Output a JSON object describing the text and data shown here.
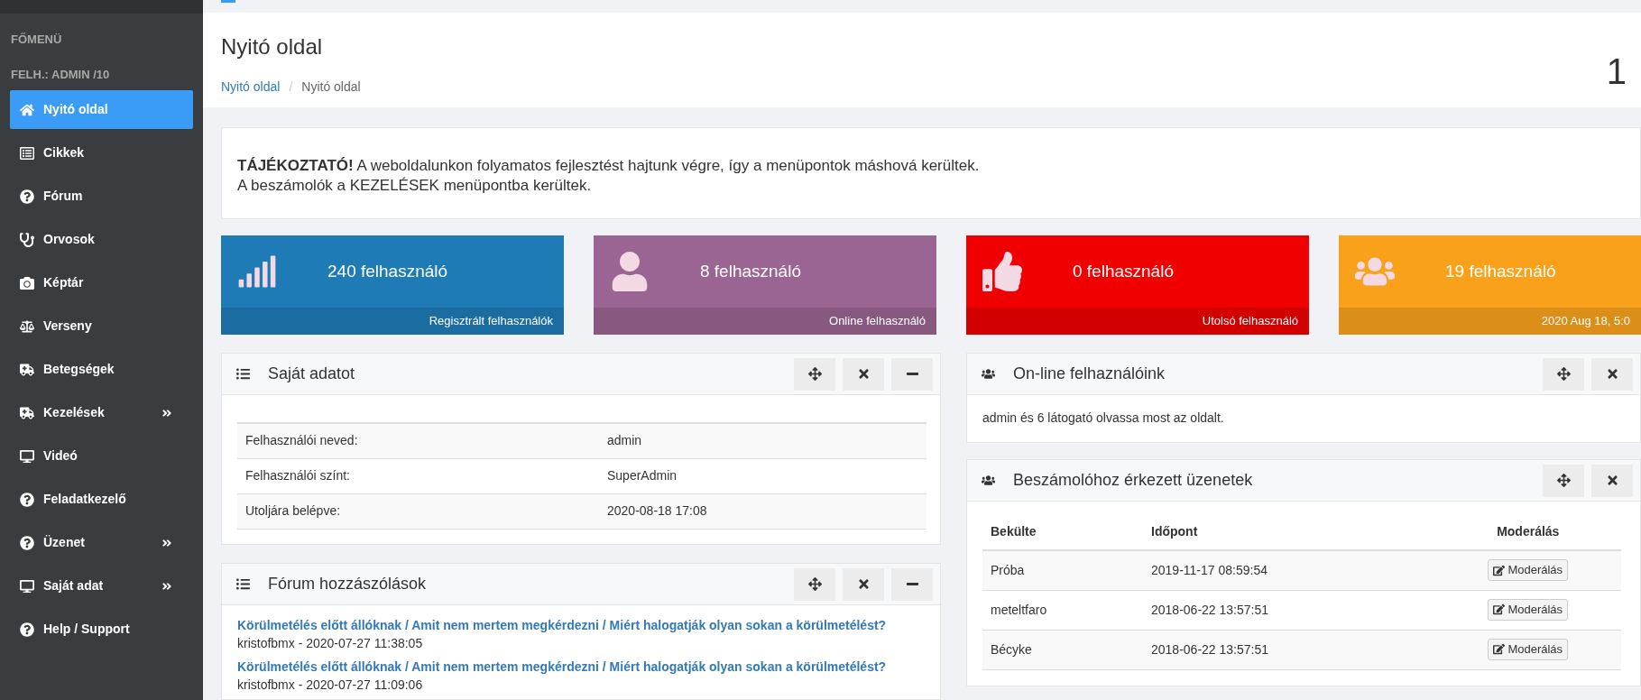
{
  "sidebar": {
    "section": "FŐMENÜ",
    "user": "FELH.: ADMIN /10",
    "items": [
      {
        "label": "Nyitó oldal",
        "selected": true,
        "submenu": false
      },
      {
        "label": "Cikkek",
        "selected": false,
        "submenu": false
      },
      {
        "label": "Fórum",
        "selected": false,
        "submenu": false
      },
      {
        "label": "Orvosok",
        "selected": false,
        "submenu": false
      },
      {
        "label": "Képtár",
        "selected": false,
        "submenu": false
      },
      {
        "label": "Verseny",
        "selected": false,
        "submenu": false
      },
      {
        "label": "Betegségek",
        "selected": false,
        "submenu": false
      },
      {
        "label": "Kezelések",
        "selected": false,
        "submenu": true
      },
      {
        "label": "Videó",
        "selected": false,
        "submenu": false
      },
      {
        "label": "Feladatkezelő",
        "selected": false,
        "submenu": false
      },
      {
        "label": "Üzenet",
        "selected": false,
        "submenu": true
      },
      {
        "label": "Saját adat",
        "selected": false,
        "submenu": true
      },
      {
        "label": "Help / Support",
        "selected": false,
        "submenu": false
      }
    ]
  },
  "header": {
    "title": "Nyitó oldal",
    "breadcrumb": [
      {
        "label": "Nyitó oldal",
        "link": true
      },
      {
        "label": "Nyitó oldal",
        "link": false
      }
    ],
    "separator": "/",
    "corner": "1"
  },
  "notice": {
    "lead": "TÁJÉKOZTATÓ!",
    "lines": [
      "A weboldalunkon folyamatos fejlesztést hajtunk végre, így a menüpontok máshová kerültek.",
      "A beszámolók a KEZELÉSEK menüpontba kerültek."
    ]
  },
  "stats": [
    {
      "value": "240 felhasználó",
      "footer": "Regisztrált felhasználók",
      "color": "#1f7bb6"
    },
    {
      "value": "8 felhasználó",
      "footer": "Online felhasználó",
      "color": "#9a6592"
    },
    {
      "value": "0 felhasználó",
      "footer": "Utolsó felhasználó",
      "color": "#f00000"
    },
    {
      "value": "19 felhasználó",
      "footer": "2020 Aug 18, 5:0",
      "color": "#f9a11b"
    }
  ],
  "own_data": {
    "title": "Saját adatot",
    "rows": [
      {
        "label": "Felhasználói neved:",
        "value": "admin"
      },
      {
        "label": "Felhasználói színt:",
        "value": "SuperAdmin"
      },
      {
        "label": "Utoljára belépve:",
        "value": "2020-08-18 17:08"
      }
    ]
  },
  "forum": {
    "title": "Fórum hozzászólások",
    "posts": [
      {
        "link": "Körülmetélés előtt állóknak / Amit nem mertem megkérdezni / Miért halogatják olyan sokan a körülmetélést?",
        "meta": "kristofbmx - 2020-07-27 11:38:05"
      },
      {
        "link": "Körülmetélés előtt állóknak / Amit nem mertem megkérdezni / Miért halogatják olyan sokan a körülmetélést?",
        "meta": "kristofbmx - 2020-07-27 11:09:06"
      }
    ]
  },
  "online": {
    "title": "On-line felhaználóink",
    "text": "admin és 6 látogató olvassa most az oldalt."
  },
  "messages": {
    "title": "Beszámolóhoz érkezett üzenetek",
    "columns": [
      "Bekülte",
      "Időpont",
      "Moderálás"
    ],
    "rows": [
      {
        "sender": "Próba",
        "time": "2019-11-17 08:59:54",
        "action": "Moderálás"
      },
      {
        "sender": "meteltfaro",
        "time": "2018-06-22 13:57:51",
        "action": "Moderálás"
      },
      {
        "sender": "Bécyke",
        "time": "2018-06-22 13:57:51",
        "action": "Moderálás"
      }
    ]
  }
}
